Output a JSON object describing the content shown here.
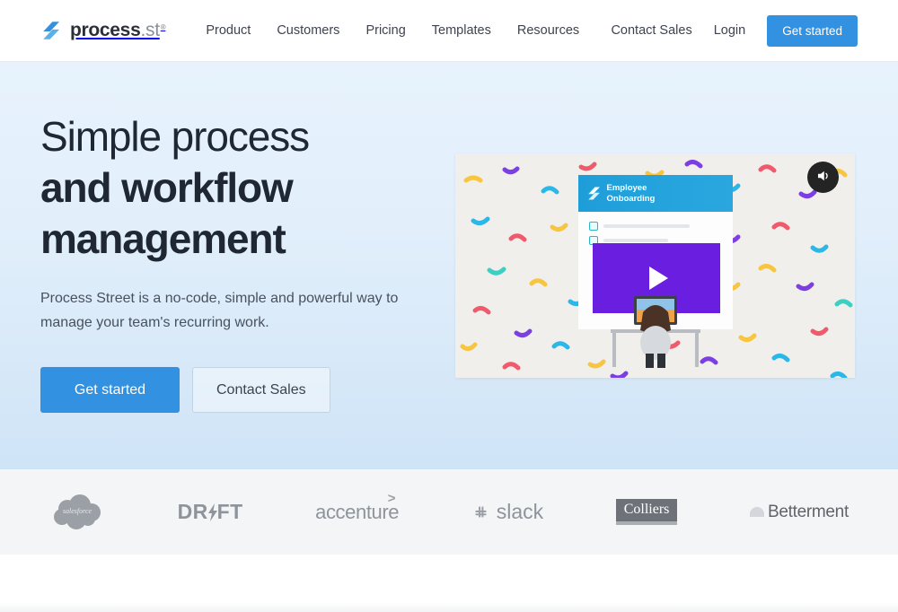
{
  "header": {
    "logo": {
      "mark": "process-st-logo-icon",
      "name": "process",
      "tld": ".st",
      "registered": "®"
    },
    "nav": [
      {
        "label": "Product"
      },
      {
        "label": "Customers"
      },
      {
        "label": "Pricing"
      },
      {
        "label": "Templates"
      },
      {
        "label": "Resources"
      }
    ],
    "contact_sales_label": "Contact Sales",
    "login_label": "Login",
    "get_started_label": "Get started"
  },
  "hero": {
    "title_line1": "Simple process",
    "title_line2": "and workflow",
    "title_line3": "management",
    "subtitle": "Process Street is a no-code, simple and powerful way to manage your team's recurring work.",
    "primary_cta": "Get started",
    "secondary_cta": "Contact Sales",
    "video": {
      "mock_banner_line1": "Employee",
      "mock_banner_line2": "Onboarding",
      "mute_icon": "speaker-icon",
      "play_icon": "play-icon"
    }
  },
  "logos": [
    {
      "name": "salesforce",
      "label": "salesforce"
    },
    {
      "name": "drift",
      "label": "DR⚡FT"
    },
    {
      "name": "accenture",
      "label": "accenture"
    },
    {
      "name": "slack",
      "label": "slack"
    },
    {
      "name": "colliers",
      "label": "Colliers"
    },
    {
      "name": "betterment",
      "label": "Betterment"
    }
  ],
  "colors": {
    "brand_blue": "#3291e0",
    "hero_gradient_top": "#e7f2fc",
    "hero_gradient_bottom": "#cfe4f7",
    "heading_dark": "#1f2733",
    "logo_band_bg": "#f4f5f7",
    "logo_gray": "#8e949b",
    "mock_banner_blue": "#1e9ed9",
    "mock_video_purple": "#6a1fe0"
  }
}
